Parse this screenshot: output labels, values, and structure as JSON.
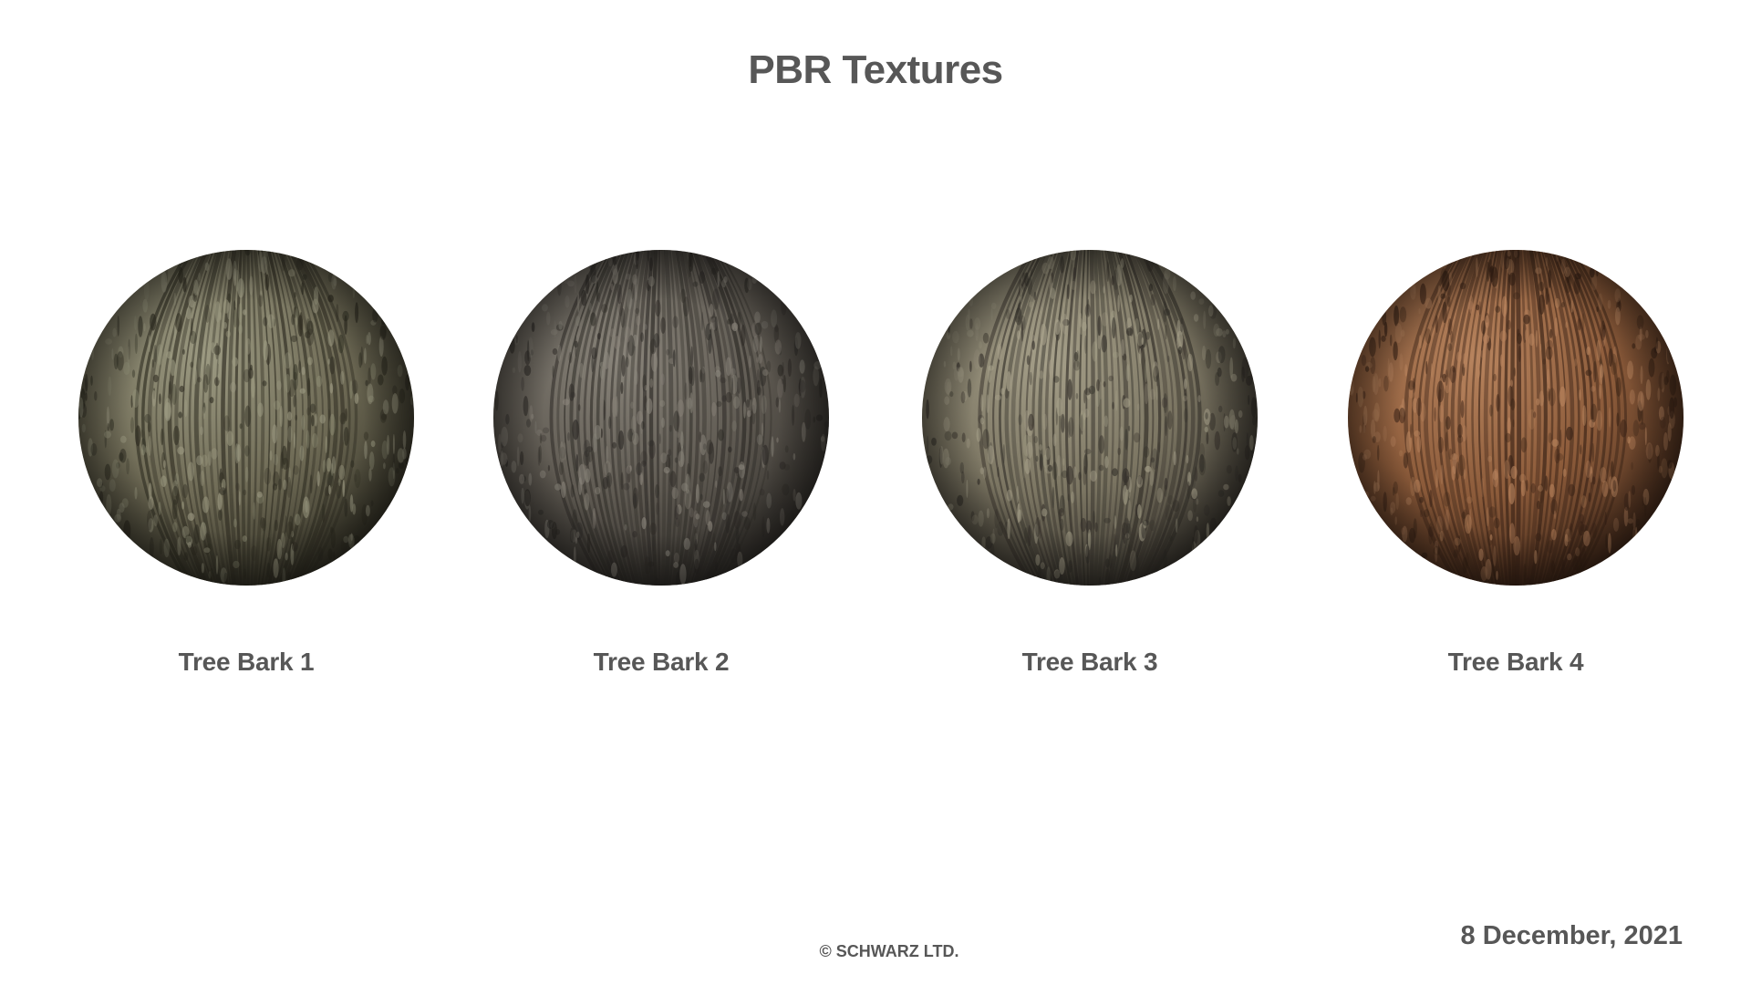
{
  "page": {
    "title": "PBR Textures",
    "copyright": "© SCHWARZ LTD.",
    "date": "8 December, 2021"
  },
  "materials": [
    {
      "label": "Tree Bark 1",
      "icon": "tree-bark-sphere-image",
      "base_color": "#6e6a55",
      "dark_color": "#2f2d22",
      "highlight_color": "#9c9a82"
    },
    {
      "label": "Tree Bark 2",
      "icon": "tree-bark-sphere-image",
      "base_color": "#5f5a52",
      "dark_color": "#2e2b27",
      "highlight_color": "#8a857b"
    },
    {
      "label": "Tree Bark 3",
      "icon": "tree-bark-sphere-image",
      "base_color": "#7b7562",
      "dark_color": "#34302a",
      "highlight_color": "#a6a08a"
    },
    {
      "label": "Tree Bark 4",
      "icon": "tree-bark-sphere-image",
      "base_color": "#8c5b3a",
      "dark_color": "#3b2417",
      "highlight_color": "#b8845e"
    }
  ]
}
